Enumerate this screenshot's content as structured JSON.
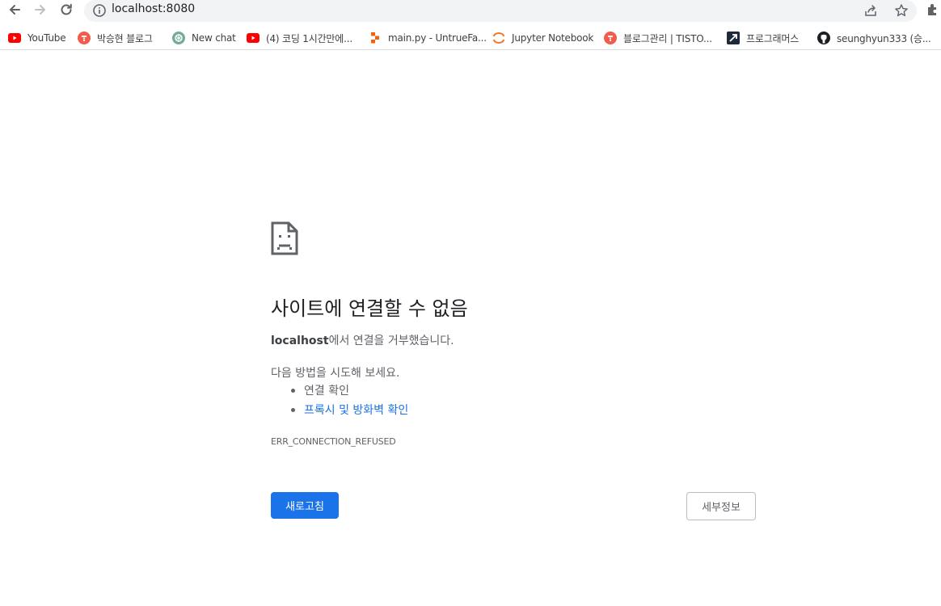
{
  "browser": {
    "url": "localhost:8080"
  },
  "bookmarks": [
    {
      "label": "YouTube",
      "icon": "youtube-icon",
      "color": "#ff0000"
    },
    {
      "label": "박승현 블로그",
      "icon": "tistory-icon",
      "color": "#f25c4d"
    },
    {
      "label": "New chat",
      "icon": "chatgpt-icon",
      "color": "#74aa9c"
    },
    {
      "label": "(4) 코딩 1시간만에...",
      "icon": "youtube-icon",
      "color": "#ff0000"
    },
    {
      "label": "main.py - UntrueFa...",
      "icon": "replit-icon",
      "color": "#f26207"
    },
    {
      "label": "Jupyter Notebook",
      "icon": "jupyter-icon",
      "color": "#f37626"
    },
    {
      "label": "블로그관리 | TISTO...",
      "icon": "tistory-icon",
      "color": "#f25c4d"
    },
    {
      "label": "프로그래머스",
      "icon": "programmers-icon",
      "color": "#1e2a3a"
    },
    {
      "label": "seunghyun333 (승...",
      "icon": "github-icon",
      "color": "#1b1f23"
    }
  ],
  "error": {
    "title": "사이트에 연결할 수 없음",
    "host": "localhost",
    "message": "에서 연결을 거부했습니다.",
    "try_intro": "다음 방법을 시도해 보세요.",
    "suggestions": [
      {
        "text": "연결 확인",
        "link": false
      },
      {
        "text": "프록시 및 방화벽 확인",
        "link": true
      }
    ],
    "code": "ERR_CONNECTION_REFUSED",
    "reload_label": "새로고침",
    "details_label": "세부정보"
  },
  "colors": {
    "primary_button": "#1a73e8",
    "link": "#1a73e8",
    "text_secondary": "#5f6368"
  }
}
